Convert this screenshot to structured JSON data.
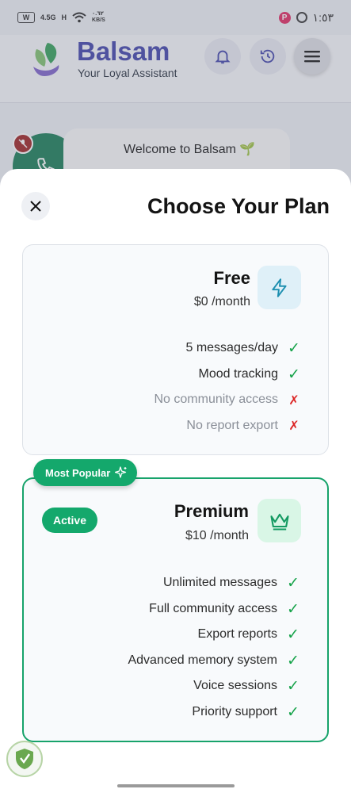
{
  "status_bar": {
    "network": "4.5G",
    "signal_label": "H",
    "speed": "٠.٦٢\nKB/S",
    "time": "١:٥٣"
  },
  "header": {
    "brand": "Balsam",
    "tagline": "Your Loyal Assistant",
    "icons": [
      "bell-icon",
      "history-icon",
      "menu-icon"
    ]
  },
  "chat": {
    "welcome_text": "Welcome to Balsam 🌱"
  },
  "plan_sheet": {
    "title": "Choose Your Plan",
    "plans": [
      {
        "name": "Free",
        "price": "$0 /month",
        "icon": "lightning-icon",
        "features": [
          {
            "label": "5 messages/day",
            "included": true,
            "mark": "✓"
          },
          {
            "label": "Mood tracking",
            "included": true,
            "mark": "✓"
          },
          {
            "label": "No community access",
            "included": false,
            "mark": "✗"
          },
          {
            "label": "No report export",
            "included": false,
            "mark": "✗"
          }
        ]
      },
      {
        "name": "Premium",
        "price": "$10 /month",
        "icon": "crown-icon",
        "badge": "Most Popular",
        "status": "Active",
        "features": [
          {
            "label": "Unlimited messages",
            "included": true,
            "mark": "✓"
          },
          {
            "label": "Full community access",
            "included": true,
            "mark": "✓"
          },
          {
            "label": "Export reports",
            "included": true,
            "mark": "✓"
          },
          {
            "label": "Advanced memory system",
            "included": true,
            "mark": "✓"
          },
          {
            "label": "Voice sessions",
            "included": true,
            "mark": "✓"
          },
          {
            "label": "Priority support",
            "included": true,
            "mark": "✓"
          }
        ]
      }
    ]
  },
  "colors": {
    "accent": "#14a86c",
    "brand": "#3b3fa8",
    "check": "#16a34a",
    "cross": "#dc2626"
  }
}
